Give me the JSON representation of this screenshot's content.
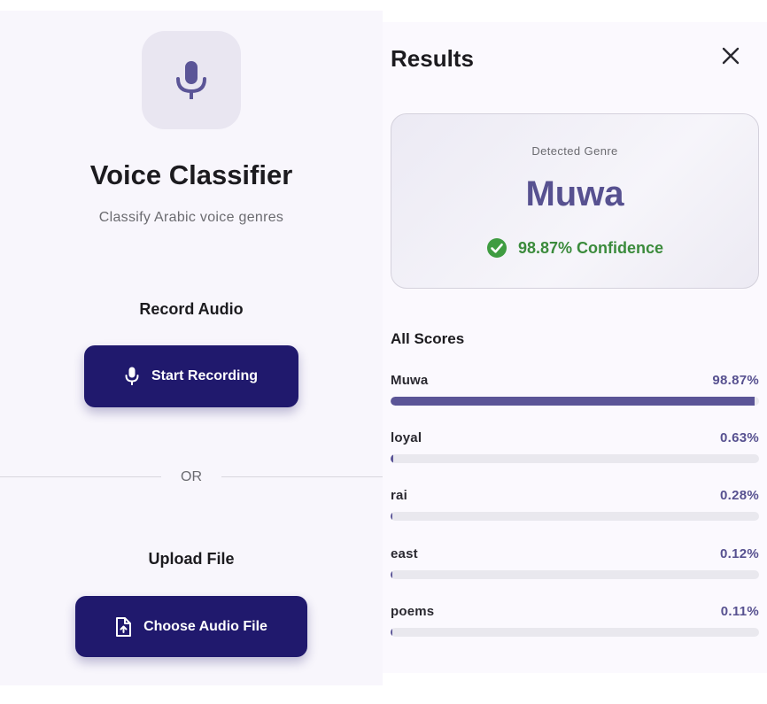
{
  "app": {
    "title": "Voice Classifier",
    "subtitle": "Classify Arabic voice genres",
    "mic_icon": "mic-icon"
  },
  "record": {
    "section_title": "Record Audio",
    "button_label": "Start Recording",
    "button_icon": "mic-icon"
  },
  "divider": {
    "label": "OR"
  },
  "upload": {
    "section_title": "Upload File",
    "button_label": "Choose Audio File",
    "button_icon": "file-upload-icon"
  },
  "results": {
    "title": "Results",
    "close_icon": "close-icon",
    "card": {
      "label": "Detected Genre",
      "genre": "Muwa",
      "confidence": "98.87% Confidence",
      "confidence_icon": "check-circle-icon"
    },
    "all_scores_title": "All Scores",
    "scores": [
      {
        "name": "Muwa",
        "value": "98.87%",
        "fraction": 0.9887
      },
      {
        "name": "loyal",
        "value": "0.63%",
        "fraction": 0.0063
      },
      {
        "name": "rai",
        "value": "0.28%",
        "fraction": 0.0028
      },
      {
        "name": "east",
        "value": "0.12%",
        "fraction": 0.0012
      },
      {
        "name": "poems",
        "value": "0.11%",
        "fraction": 0.0011
      }
    ]
  },
  "colors": {
    "primary": "#20196d",
    "accent": "#575190",
    "success": "#3b8b3c",
    "bar_fill": "#5b5597",
    "bar_track": "#e9e8ee"
  }
}
